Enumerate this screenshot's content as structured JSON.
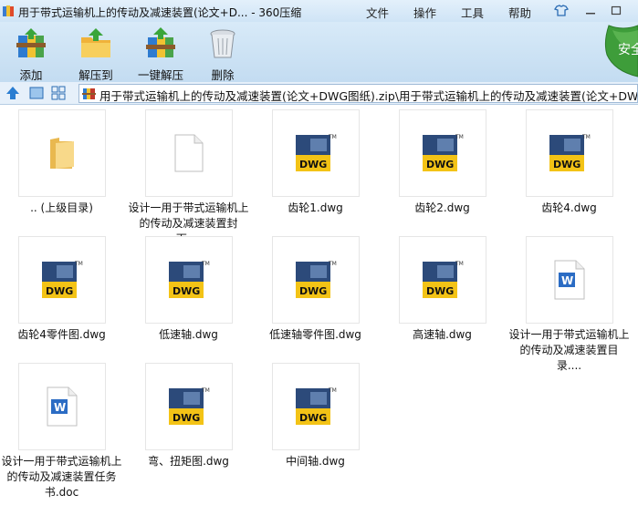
{
  "window": {
    "title": "用于带式运输机上的传动及减速装置(论文+D... - 360压缩",
    "menus": [
      "文件",
      "操作",
      "工具",
      "帮助"
    ]
  },
  "toolbar": {
    "add_label": "添加",
    "extract_to_label": "解压到",
    "one_click_label": "一键解压",
    "delete_label": "删除",
    "security_label": "安全"
  },
  "address": {
    "path": "用于带式运输机上的传动及减速装置(论文+DWG图纸).zip\\用于带式运输机上的传动及减速装置(论文+DWG图"
  },
  "files": [
    {
      "name": ".. (上级目录)",
      "icon": "folder-icon"
    },
    {
      "name": "设计一用于带式运输机上的传动及减速装置封面....",
      "icon": "blank-file-icon"
    },
    {
      "name": "齿轮1.dwg",
      "icon": "dwg-icon"
    },
    {
      "name": "齿轮2.dwg",
      "icon": "dwg-icon"
    },
    {
      "name": "齿轮4.dwg",
      "icon": "dwg-icon"
    },
    {
      "name": "齿轮4零件图.dwg",
      "icon": "dwg-icon"
    },
    {
      "name": "低速轴.dwg",
      "icon": "dwg-icon"
    },
    {
      "name": "低速轴零件图.dwg",
      "icon": "dwg-icon"
    },
    {
      "name": "高速轴.dwg",
      "icon": "dwg-icon"
    },
    {
      "name": "设计一用于带式运输机上的传动及减速装置目录....",
      "icon": "word-doc-icon"
    },
    {
      "name": "设计一用于带式运输机上的传动及减速装置任务书.doc",
      "icon": "word-doc-icon"
    },
    {
      "name": "弯、扭矩图.dwg",
      "icon": "dwg-icon"
    },
    {
      "name": "中间轴.dwg",
      "icon": "dwg-icon"
    }
  ],
  "colors": {
    "dwg_blue": "#2c4a7a",
    "dwg_yellow": "#f3c316",
    "folder_yellow": "#f5d27a",
    "word_blue": "#2b6cc4"
  }
}
